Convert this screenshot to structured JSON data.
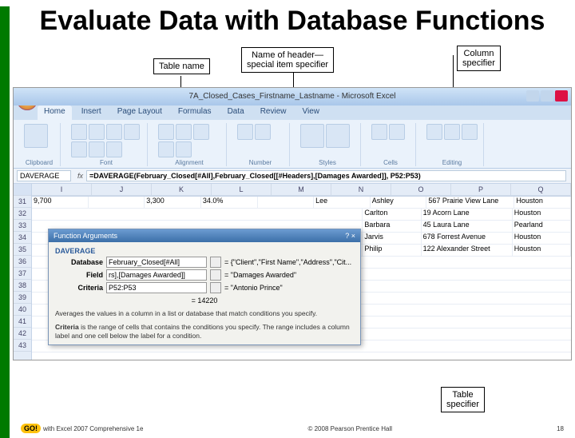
{
  "title": "Evaluate Data with Database Functions",
  "callouts": {
    "table_name": "Table name",
    "header_name": "Name of header—\nspecial item specifier",
    "col_spec": "Column\nspecifier",
    "table_spec": "Table\nspecifier"
  },
  "window": {
    "title": "7A_Closed_Cases_Firstname_Lastname - Microsoft Excel"
  },
  "ribbon": {
    "tabs": [
      "Home",
      "Insert",
      "Page Layout",
      "Formulas",
      "Data",
      "Review",
      "View"
    ],
    "active": "Home",
    "groups": [
      "Clipboard",
      "Font",
      "Alignment",
      "Number",
      "Styles",
      "Cells",
      "Editing"
    ]
  },
  "namebox": "DAVERAGE",
  "formula": "=DAVERAGE(February_Closed[#All],February_Closed[[#Headers],[Damages Awarded]], P52:P53)",
  "cols": [
    "I",
    "J",
    "K",
    "L",
    "M",
    "N",
    "O",
    "P",
    "Q"
  ],
  "rows": [
    "31",
    "32",
    "33",
    "34",
    "35",
    "36",
    "37",
    "38",
    "39",
    "40",
    "41",
    "42",
    "43"
  ],
  "data_row1": {
    "I": "9,700",
    "K": "3,300",
    "L": "34.0%",
    "N": "Lee",
    "O": "Ashley",
    "P": "567 Prairie View Lane",
    "Q": "Houston"
  },
  "people": [
    {
      "n": "Carlton",
      "a": "19 Acorn Lane",
      "c": "Houston"
    },
    {
      "n": "Barbara",
      "a": "45 Laura Lane",
      "c": "Pearland"
    },
    {
      "n": "Jarvis",
      "a": "678 Forrest Avenue",
      "c": "Houston"
    },
    {
      "n": "Philip",
      "a": "122 Alexander Street",
      "c": "Houston"
    }
  ],
  "dialog": {
    "title": "Function Arguments",
    "fn": "DAVERAGE",
    "fields": {
      "database": {
        "lbl": "Database",
        "val": "February_Closed[#All]",
        "eq": "= {\"Client\",\"First Name\",\"Address\",\"Cit..."
      },
      "field": {
        "lbl": "Field",
        "val": "rs],[Damages Awarded]]",
        "eq": "= \"Damages Awarded\""
      },
      "criteria": {
        "lbl": "Criteria",
        "val": "P52:P53",
        "eq": "= \"Antonio Prince\""
      }
    },
    "result": "= 14220",
    "desc": "Averages the values in a column in a list or database that match conditions you specify.",
    "crit_help_lbl": "Criteria",
    "crit_help": "is the range of cells that contains the conditions you specify. The range includes a column label and one cell below the label for a condition."
  },
  "footer": {
    "left": "with Excel 2007 Comprehensive 1e",
    "center": "© 2008 Pearson Prentice Hall",
    "page": "18",
    "go": "GO!"
  }
}
